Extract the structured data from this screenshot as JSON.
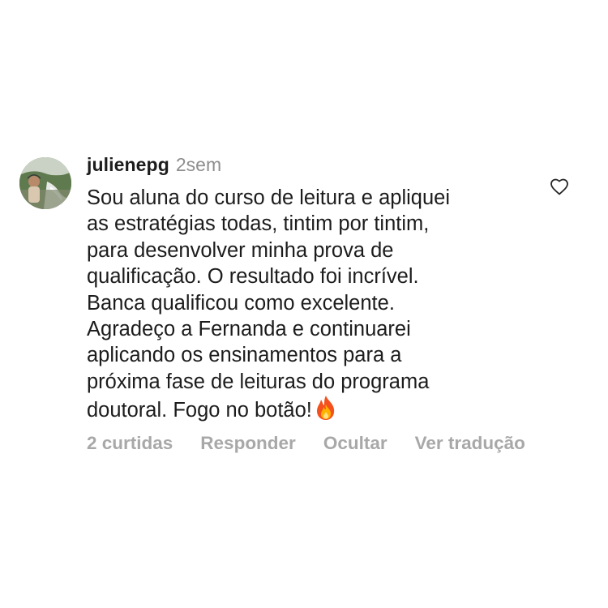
{
  "comment": {
    "username": "julienepg",
    "time": "2sem",
    "text_lines": [
      "Sou aluna do curso de leitura e apliquei",
      "as estratégias todas, tintim por tintim,",
      "para desenvolver minha prova de",
      "qualificação. O resultado foi incrível.",
      "Banca qualificou como excelente.",
      "Agradeço a Fernanda e continuarei",
      "aplicando os ensinamentos para a",
      "próxima fase de leituras do programa",
      "doutoral. Fogo no botão!"
    ],
    "emoji_icon": "fire-icon",
    "like_icon": "heart-outline-icon",
    "actions": {
      "likes": "2 curtidas",
      "reply": "Responder",
      "hide": "Ocultar",
      "translate": "Ver tradução"
    }
  },
  "colors": {
    "text": "#1c1c1c",
    "muted": "#8e8e8e",
    "action": "#a8a8a8",
    "background": "#ffffff"
  }
}
